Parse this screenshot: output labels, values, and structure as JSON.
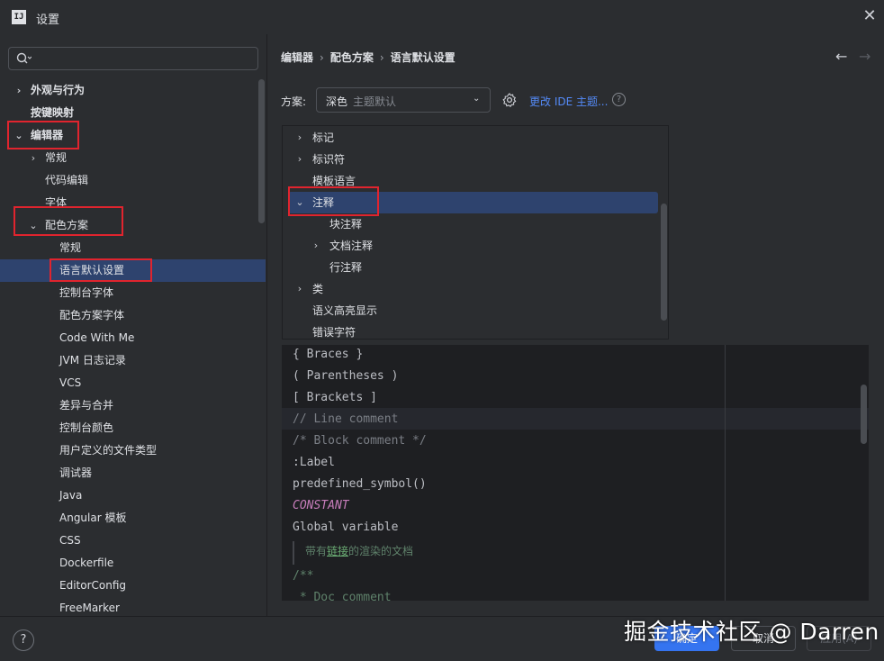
{
  "window": {
    "title": "设置",
    "app_icon_text": "IJ"
  },
  "left_tree": {
    "items": [
      {
        "label": "外观与行为",
        "chevron": "›",
        "bold": true,
        "indent": 0
      },
      {
        "label": "按键映射",
        "chevron": "",
        "bold": true,
        "indent": 0
      },
      {
        "label": "编辑器",
        "chevron": "⌄",
        "bold": true,
        "indent": 0
      },
      {
        "label": "常规",
        "chevron": "›",
        "bold": false,
        "indent": 1
      },
      {
        "label": "代码编辑",
        "chevron": "",
        "bold": false,
        "indent": 1
      },
      {
        "label": "字体",
        "chevron": "",
        "bold": false,
        "indent": 1
      },
      {
        "label": "配色方案",
        "chevron": "⌄",
        "bold": false,
        "indent": 1
      },
      {
        "label": "常规",
        "chevron": "",
        "bold": false,
        "indent": 2
      },
      {
        "label": "语言默认设置",
        "chevron": "",
        "bold": false,
        "indent": 2,
        "selected": true
      },
      {
        "label": "控制台字体",
        "chevron": "",
        "bold": false,
        "indent": 2
      },
      {
        "label": "配色方案字体",
        "chevron": "",
        "bold": false,
        "indent": 2
      },
      {
        "label": "Code With Me",
        "chevron": "",
        "bold": false,
        "indent": 2
      },
      {
        "label": "JVM 日志记录",
        "chevron": "",
        "bold": false,
        "indent": 2
      },
      {
        "label": "VCS",
        "chevron": "",
        "bold": false,
        "indent": 2
      },
      {
        "label": "差异与合并",
        "chevron": "",
        "bold": false,
        "indent": 2
      },
      {
        "label": "控制台颜色",
        "chevron": "",
        "bold": false,
        "indent": 2
      },
      {
        "label": "用户定义的文件类型",
        "chevron": "",
        "bold": false,
        "indent": 2
      },
      {
        "label": "调试器",
        "chevron": "",
        "bold": false,
        "indent": 2
      },
      {
        "label": "Java",
        "chevron": "",
        "bold": false,
        "indent": 2
      },
      {
        "label": "Angular 模板",
        "chevron": "",
        "bold": false,
        "indent": 2
      },
      {
        "label": "CSS",
        "chevron": "",
        "bold": false,
        "indent": 2
      },
      {
        "label": "Dockerfile",
        "chevron": "",
        "bold": false,
        "indent": 2
      },
      {
        "label": "EditorConfig",
        "chevron": "",
        "bold": false,
        "indent": 2
      },
      {
        "label": "FreeMarker",
        "chevron": "",
        "bold": false,
        "indent": 2
      }
    ]
  },
  "breadcrumb": [
    "编辑器",
    "配色方案",
    "语言默认设置"
  ],
  "scheme": {
    "label": "方案:",
    "value": "深色",
    "hint": "主题默认",
    "change_link": "更改 IDE 主题..."
  },
  "right_tree": {
    "items": [
      {
        "label": "标记",
        "chevron": "›",
        "indent": 0
      },
      {
        "label": "标识符",
        "chevron": "›",
        "indent": 0
      },
      {
        "label": "模板语言",
        "chevron": "",
        "indent": 0
      },
      {
        "label": "注释",
        "chevron": "⌄",
        "indent": 0,
        "selected": true
      },
      {
        "label": "块注释",
        "chevron": "",
        "indent": 1
      },
      {
        "label": "文档注释",
        "chevron": "›",
        "indent": 1
      },
      {
        "label": "行注释",
        "chevron": "",
        "indent": 1
      },
      {
        "label": "类",
        "chevron": "›",
        "indent": 0
      },
      {
        "label": "语义高亮显示",
        "chevron": "",
        "indent": 0
      },
      {
        "label": "错误字符",
        "chevron": "",
        "indent": 0
      }
    ]
  },
  "preview": {
    "lines": [
      {
        "text": "{ Braces }",
        "color": "#bcbec4",
        "italic": false
      },
      {
        "text": "( Parentheses )",
        "color": "#bcbec4",
        "italic": false
      },
      {
        "text": "[ Brackets ]",
        "color": "#bcbec4",
        "italic": false
      },
      {
        "text": "// Line comment",
        "color": "#7a7e85",
        "italic": false
      },
      {
        "text": "/* Block comment */",
        "color": "#7a7e85",
        "italic": false
      },
      {
        "text": ":Label",
        "color": "#bcbec4",
        "italic": false
      },
      {
        "text": "predefined_symbol()",
        "color": "#bcbec4",
        "italic": false
      },
      {
        "text": "CONSTANT",
        "color": "#c77dbb",
        "italic": true
      },
      {
        "text": "Global variable",
        "color": "#bcbec4",
        "italic": false
      },
      {
        "text": "/**",
        "color": "#5f826b",
        "italic": false
      },
      {
        "text": " * Doc comment",
        "color": "#5f826b",
        "italic": false
      }
    ],
    "doc_prefix": "带有",
    "doc_link": "链接",
    "doc_suffix": "的渲染的文档"
  },
  "buttons": {
    "ok": "确定",
    "cancel": "取消",
    "apply": "应用(A)",
    "help": "?"
  },
  "nav": {
    "back": "←",
    "forward": "→"
  },
  "watermark": "掘金技术社区 @ Darren",
  "colors": {
    "accent": "#3574f0",
    "selection": "#2e436e",
    "link": "#548af7",
    "annotation": "#e0242e"
  }
}
